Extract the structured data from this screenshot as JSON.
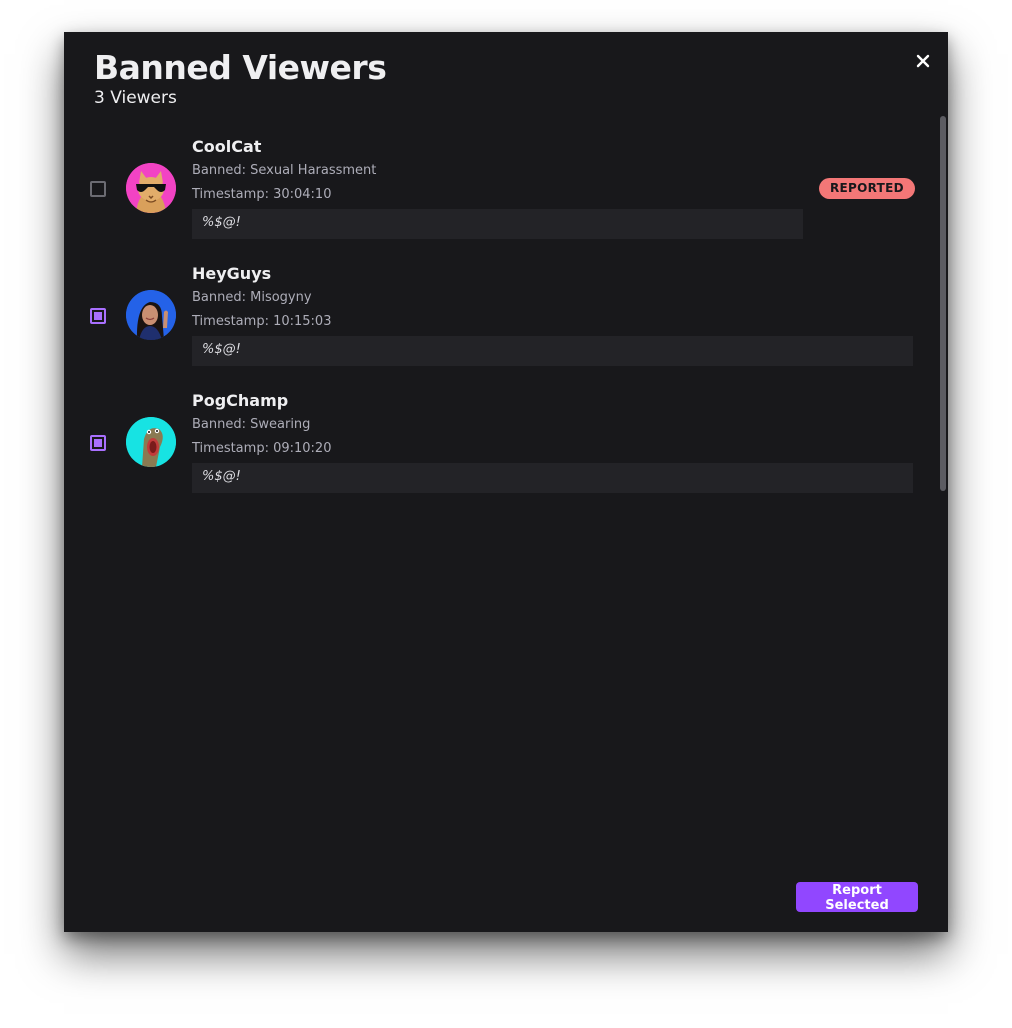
{
  "modal": {
    "title": "Banned Viewers",
    "subtitle": "3 Viewers",
    "close_icon": "close-icon",
    "report_button_label": "Report Selected"
  },
  "viewers": [
    {
      "username": "CoolCat",
      "reason": "Banned: Sexual Harassment",
      "timestamp": "Timestamp: 30:04:10",
      "message": "%$@!",
      "checked": false,
      "badge": "REPORTED",
      "avatar_icon": "cat-with-sunglasses-avatar"
    },
    {
      "username": "HeyGuys",
      "reason": "Banned: Misogyny",
      "timestamp": "Timestamp: 10:15:03",
      "message": "%$@!",
      "checked": true,
      "avatar_icon": "waving-woman-avatar"
    },
    {
      "username": "PogChamp",
      "reason": "Banned: Swearing",
      "timestamp": "Timestamp: 09:10:20",
      "message": "%$@!",
      "checked": true,
      "avatar_icon": "surprised-lizard-avatar"
    }
  ],
  "colors": {
    "background": "#18181b",
    "accent": "#9147ff",
    "checkbox_checked": "#a970ff",
    "badge": "#f37777",
    "message_bg": "#232327"
  }
}
